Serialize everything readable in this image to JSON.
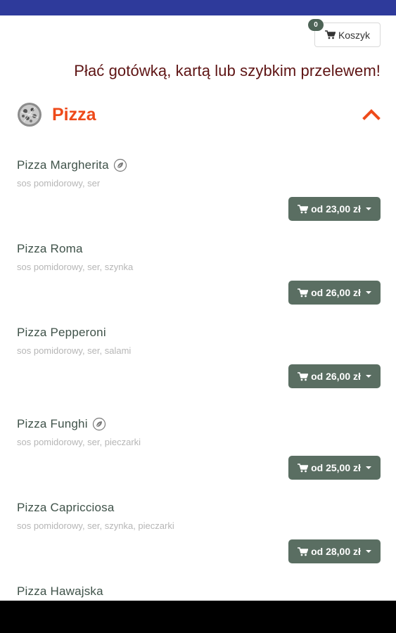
{
  "cart": {
    "badge_count": "0",
    "label": "Koszyk"
  },
  "headline": "Płać gotówką, kartą lub szybkim przelewem!",
  "category": {
    "title": "Pizza",
    "icon": "pizza-thumbnail",
    "expanded": true
  },
  "items": [
    {
      "name": "Pizza Margherita",
      "vegetarian": true,
      "description": "sos pomidorowy, ser",
      "price": "od 23,00 zł"
    },
    {
      "name": "Pizza Roma",
      "vegetarian": false,
      "description": "sos pomidorowy, ser, szynka",
      "price": "od 26,00 zł"
    },
    {
      "name": "Pizza Pepperoni",
      "vegetarian": false,
      "description": "sos pomidorowy, ser, salami",
      "price": "od 26,00 zł"
    },
    {
      "name": "Pizza Funghi",
      "vegetarian": true,
      "description": "sos pomidorowy, ser, pieczarki",
      "price": "od 25,00 zł"
    },
    {
      "name": "Pizza Capricciosa",
      "vegetarian": false,
      "description": "sos pomidorowy, ser, szynka, pieczarki",
      "price": "od 28,00 zł"
    },
    {
      "name": "Pizza Hawajska"
    }
  ],
  "colors": {
    "status_bar": "#2e3a9b",
    "headline": "#5e1414",
    "category_accent": "#ee4a1a",
    "price_button": "#5a6e62",
    "item_name": "#3f5249",
    "description": "#b6b6b6"
  }
}
